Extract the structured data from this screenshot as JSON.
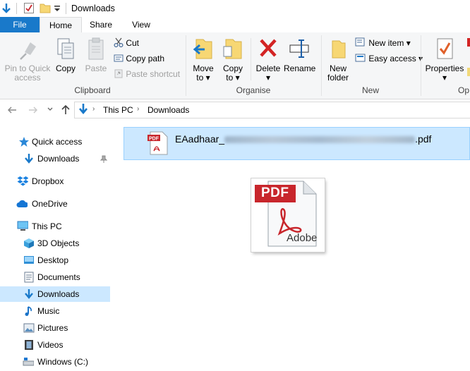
{
  "window": {
    "title": "Downloads"
  },
  "ribbon_tabs": {
    "file": "File",
    "home": "Home",
    "share": "Share",
    "view": "View"
  },
  "clipboard": {
    "pin_line1": "Pin to Quick",
    "pin_line2": "access",
    "copy": "Copy",
    "paste": "Paste",
    "cut": "Cut",
    "copy_path": "Copy path",
    "paste_shortcut": "Paste shortcut",
    "group_label": "Clipboard"
  },
  "organise": {
    "move_line1": "Move",
    "move_line2": "to",
    "copy_line1": "Copy",
    "copy_line2": "to",
    "delete": "Delete",
    "rename": "Rename",
    "group_label": "Organise"
  },
  "new_group": {
    "new_folder_line1": "New",
    "new_folder_line2": "folder",
    "new_item": "New item",
    "easy_access": "Easy access",
    "group_label": "New"
  },
  "open_group": {
    "properties": "Properties",
    "group_label_partial": "Op"
  },
  "address": {
    "crumbs": [
      "This PC",
      "Downloads"
    ]
  },
  "nav": {
    "quick_access": "Quick access",
    "qa_downloads": "Downloads",
    "dropbox": "Dropbox",
    "onedrive": "OneDrive",
    "this_pc": "This PC",
    "objects3d": "3D Objects",
    "desktop": "Desktop",
    "documents": "Documents",
    "downloads": "Downloads",
    "music": "Music",
    "pictures": "Pictures",
    "videos": "Videos",
    "windows_c": "Windows (C:)"
  },
  "file": {
    "name_prefix": "EAadhaar_",
    "name_suffix": ".pdf",
    "icon_badge": "PDF",
    "icon_caption": "Adobe"
  },
  "colors": {
    "accent": "#1979ca",
    "selection": "#cce8ff",
    "pdf_red": "#c8262c"
  }
}
